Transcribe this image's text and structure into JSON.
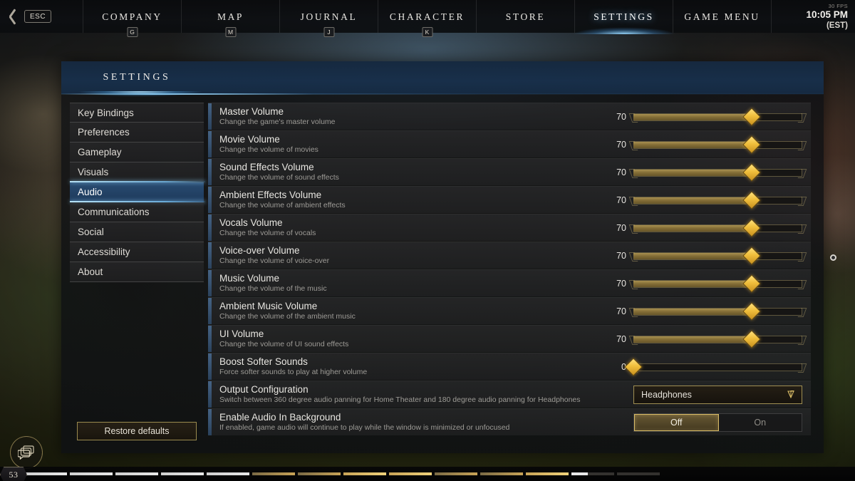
{
  "topnav": {
    "esc_label": "ESC",
    "back_icon": "back-chevron-icon",
    "items": [
      {
        "label": "COMPANY",
        "key": "G",
        "active": false
      },
      {
        "label": "MAP",
        "key": "M",
        "active": false
      },
      {
        "label": "JOURNAL",
        "key": "J",
        "active": false
      },
      {
        "label": "CHARACTER",
        "key": "K",
        "active": false
      },
      {
        "label": "STORE",
        "key": "",
        "active": false
      },
      {
        "label": "SETTINGS",
        "key": "",
        "active": true
      },
      {
        "label": "GAME MENU",
        "key": "",
        "active": false
      }
    ],
    "fps": "30 FPS",
    "time": "10:05 PM",
    "timezone": "(EST)"
  },
  "panel": {
    "title": "SETTINGS",
    "restore_defaults_label": "Restore defaults"
  },
  "sidebar": {
    "items": [
      {
        "label": "Key Bindings",
        "active": false
      },
      {
        "label": "Preferences",
        "active": false
      },
      {
        "label": "Gameplay",
        "active": false
      },
      {
        "label": "Visuals",
        "active": false
      },
      {
        "label": "Audio",
        "active": true
      },
      {
        "label": "Communications",
        "active": false
      },
      {
        "label": "Social",
        "active": false
      },
      {
        "label": "Accessibility",
        "active": false
      },
      {
        "label": "About",
        "active": false
      }
    ]
  },
  "settings": {
    "rows": [
      {
        "title": "Master Volume",
        "desc": "Change the game's master volume",
        "type": "slider",
        "value": "70",
        "pct": 70
      },
      {
        "title": "Movie Volume",
        "desc": "Change the volume of movies",
        "type": "slider",
        "value": "70",
        "pct": 70
      },
      {
        "title": "Sound Effects Volume",
        "desc": "Change the volume of sound effects",
        "type": "slider",
        "value": "70",
        "pct": 70
      },
      {
        "title": "Ambient Effects Volume",
        "desc": "Change the volume of ambient effects",
        "type": "slider",
        "value": "70",
        "pct": 70
      },
      {
        "title": "Vocals Volume",
        "desc": "Change the volume of vocals",
        "type": "slider",
        "value": "70",
        "pct": 70
      },
      {
        "title": "Voice-over Volume",
        "desc": "Change the volume of voice-over",
        "type": "slider",
        "value": "70",
        "pct": 70
      },
      {
        "title": "Music Volume",
        "desc": "Change the volume of the music",
        "type": "slider",
        "value": "70",
        "pct": 70
      },
      {
        "title": "Ambient Music Volume",
        "desc": "Change the volume of the ambient music",
        "type": "slider",
        "value": "70",
        "pct": 70
      },
      {
        "title": "UI Volume",
        "desc": "Change the volume of UI sound effects",
        "type": "slider",
        "value": "70",
        "pct": 70
      },
      {
        "title": "Boost Softer Sounds",
        "desc": "Force softer sounds to play at higher volume",
        "type": "slider",
        "value": "0",
        "pct": 0
      },
      {
        "title": "Output Configuration",
        "desc": "Switch between 360 degree audio panning for Home Theater and 180 degree audio panning for Headphones",
        "type": "dropdown",
        "value": "Headphones"
      },
      {
        "title": "Enable Audio In Background",
        "desc": "If enabled, game audio will continue to play while the window is minimized or unfocused",
        "type": "toggle",
        "off_label": "Off",
        "on_label": "On",
        "selected": "Off"
      }
    ]
  },
  "hud": {
    "chat_icon": "chat-bubbles-icon",
    "level": "53"
  },
  "colors": {
    "accent_gold": "#e0b43c",
    "accent_blue": "#8ed2ff",
    "panel_bg": "#0e1013",
    "row_bg": "#343436",
    "text_primary": "#e8e6e1",
    "text_secondary": "#9d9b96"
  }
}
